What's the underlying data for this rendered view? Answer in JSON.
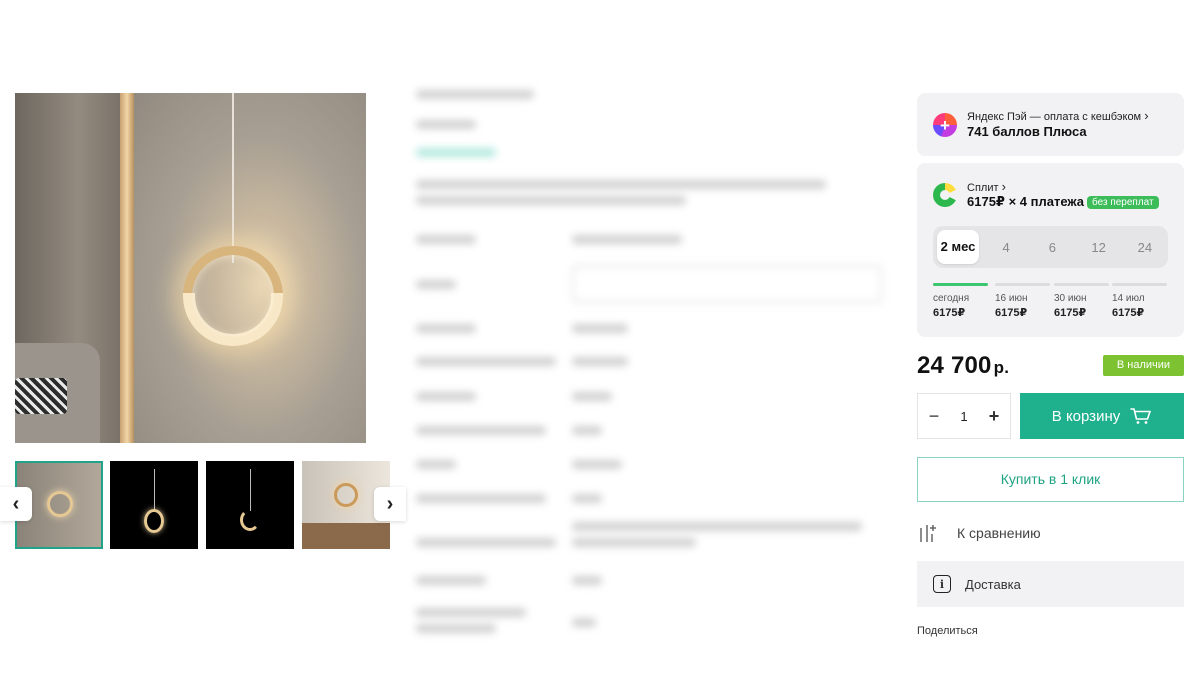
{
  "gallery": {
    "prev_icon": "chevron-left-icon",
    "next_icon": "chevron-right-icon",
    "prev_glyph": "‹",
    "next_glyph": "›",
    "thumbnail_count": 4,
    "active_thumbnail_index": 0
  },
  "yandex_pay": {
    "title": "Яндекс Пэй — оплата с кешбэком",
    "arrow": "›",
    "points": "741 баллов Плюса",
    "icon": "plus-icon",
    "icon_glyph": "+"
  },
  "split": {
    "title": "Сплит",
    "arrow": "›",
    "installment": "6175₽ × 4 платежа",
    "badge": "без переплат",
    "icon": "split-icon",
    "periods": [
      "2 мес",
      "4",
      "6",
      "12",
      "24"
    ],
    "selected_period": "2 мес",
    "schedule": [
      {
        "date": "сегодня",
        "amount": "6175₽",
        "paid": true
      },
      {
        "date": "16 июн",
        "amount": "6175₽",
        "paid": false
      },
      {
        "date": "30 июн",
        "amount": "6175₽",
        "paid": false
      },
      {
        "date": "14 июл",
        "amount": "6175₽",
        "paid": false
      }
    ]
  },
  "price": {
    "value": "24 700",
    "currency": "р."
  },
  "stock_badge": "В наличии",
  "quantity": {
    "minus": "−",
    "value": "1",
    "plus": "+"
  },
  "buttons": {
    "cart": "В корзину",
    "cart_icon": "cart-icon",
    "buy_one_click": "Купить в 1 клик",
    "compare": "К сравнению",
    "compare_icon": "compare-icon",
    "delivery": "Доставка",
    "delivery_icon": "info-icon",
    "share": "Поделиться"
  },
  "colors": {
    "accent": "#1fb08d",
    "stock": "#7cc231",
    "split_badge": "#3cbd5a",
    "active_thumb_border": "#21a38a"
  }
}
